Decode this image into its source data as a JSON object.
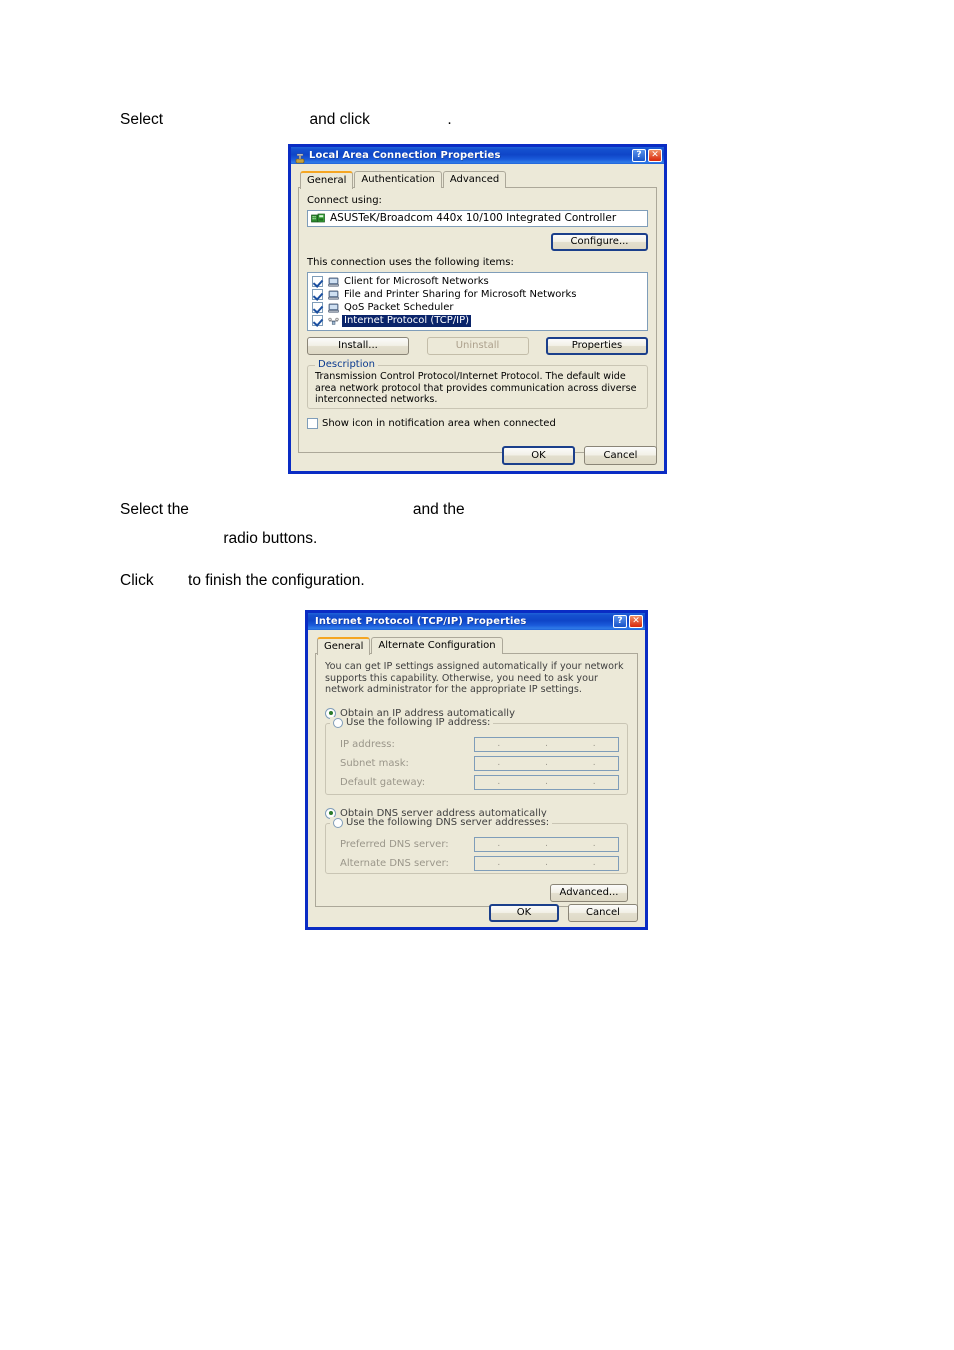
{
  "document": {
    "lines": [
      {
        "id": "step1",
        "prefix": "Select",
        "hidden1": "                                  ",
        "mid": "and click",
        "hidden2": "                  ",
        "suffix": "."
      },
      {
        "id": "step2a",
        "prefix": "Select the",
        "hidden1": "                                                    ",
        "suffix": "and the"
      },
      {
        "id": "step2b",
        "hidden1": "                        ",
        "suffix": "radio buttons."
      },
      {
        "id": "step3",
        "prefix": "Click",
        "hidden1": "        ",
        "suffix": "to finish the configuration."
      }
    ]
  },
  "dialog1": {
    "title": "Local Area Connection Properties",
    "title_icon": "network-connection-icon",
    "help_button": "?",
    "close_button": "✕",
    "tabs": [
      {
        "label": "General",
        "active": true
      },
      {
        "label": "Authentication",
        "active": false
      },
      {
        "label": "Advanced",
        "active": false
      }
    ],
    "connect_using_label": "Connect using:",
    "adapter": "ASUSTeK/Broadcom 440x 10/100 Integrated Controller",
    "adapter_icon": "network-adapter-icon",
    "configure_button": "Configure...",
    "items_label": "This connection uses the following items:",
    "items": [
      {
        "label": "Client for Microsoft Networks",
        "checked": true,
        "selected": false,
        "icon": "computer-icon"
      },
      {
        "label": "File and Printer Sharing for Microsoft Networks",
        "checked": true,
        "selected": false,
        "icon": "computer-icon"
      },
      {
        "label": "QoS Packet Scheduler",
        "checked": true,
        "selected": false,
        "icon": "computer-icon"
      },
      {
        "label": "Internet Protocol (TCP/IP)",
        "checked": true,
        "selected": true,
        "icon": "protocol-icon"
      }
    ],
    "install_button": "Install...",
    "uninstall_button": "Uninstall",
    "properties_button": "Properties",
    "description_title": "Description",
    "description_text": "Transmission Control Protocol/Internet Protocol. The default wide area network protocol that provides communication across diverse interconnected networks.",
    "show_icon_checkbox": "Show icon in notification area when connected",
    "show_icon_checked": false,
    "ok_button": "OK",
    "cancel_button": "Cancel"
  },
  "dialog2": {
    "title": "Internet Protocol (TCP/IP) Properties",
    "help_button": "?",
    "close_button": "✕",
    "tabs": [
      {
        "label": "General",
        "active": true
      },
      {
        "label": "Alternate Configuration",
        "active": false
      }
    ],
    "intro_text": "You can get IP settings assigned automatically if your network supports this capability. Otherwise, you need to ask your network administrator for the appropriate IP settings.",
    "radio_obtain_ip": "Obtain an IP address automatically",
    "radio_obtain_ip_selected": true,
    "radio_use_ip": "Use the following IP address:",
    "radio_use_ip_selected": false,
    "ip_address_label": "IP address:",
    "subnet_mask_label": "Subnet mask:",
    "default_gateway_label": "Default gateway:",
    "ip_address_value": "",
    "subnet_mask_value": "",
    "default_gateway_value": "",
    "radio_obtain_dns": "Obtain DNS server address automatically",
    "radio_obtain_dns_selected": true,
    "radio_use_dns": "Use the following DNS  server addresses:",
    "radio_use_dns_selected": false,
    "preferred_dns_label": "Preferred DNS server:",
    "alternate_dns_label": "Alternate DNS server:",
    "preferred_dns_value": "",
    "alternate_dns_value": "",
    "advanced_button": "Advanced...",
    "ok_button": "OK",
    "cancel_button": "Cancel"
  },
  "colors": {
    "titlebar_blue": "#1450cf",
    "dialog_border": "#0a2cc4",
    "dialog_face": "#ece9d8",
    "selection_blue": "#0a246a",
    "tab_accent_orange": "#f5a623",
    "group_title_blue": "#0a3a8f",
    "close_red": "#d8280c"
  }
}
